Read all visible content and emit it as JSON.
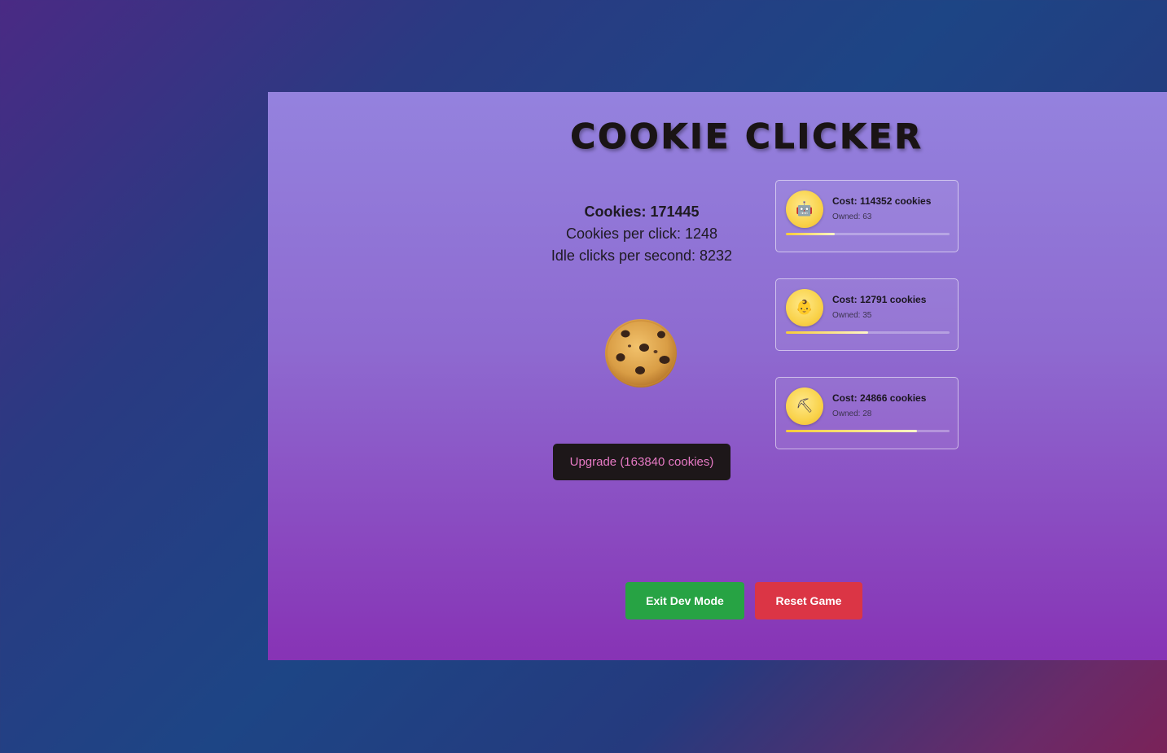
{
  "title": "COOKIE CLICKER",
  "stats": {
    "cookies_text": "Cookies: 171445",
    "per_click_text": "Cookies per click: 1248",
    "idle_text": "Idle clicks per second: 8232"
  },
  "upgrade": {
    "label": "Upgrade (163840 cookies)"
  },
  "shop": {
    "items": [
      {
        "icon": "robot-icon",
        "glyph": "🤖",
        "cost": "Cost: 114352 cookies",
        "owned": "Owned: 63",
        "progress": 0.3
      },
      {
        "icon": "baby-icon",
        "glyph": "👶",
        "cost": "Cost: 12791 cookies",
        "owned": "Owned: 35",
        "progress": 0.5
      },
      {
        "icon": "pickaxe-icon",
        "glyph": "⛏",
        "cost": "Cost: 24866 cookies",
        "owned": "Owned: 28",
        "progress": 0.8
      }
    ]
  },
  "controls": {
    "exit_label": "Exit Dev Mode",
    "reset_label": "Reset Game"
  },
  "colors": {
    "exit": "#27a344",
    "reset": "#db3545",
    "upgrade_text": "#e77ac5"
  }
}
